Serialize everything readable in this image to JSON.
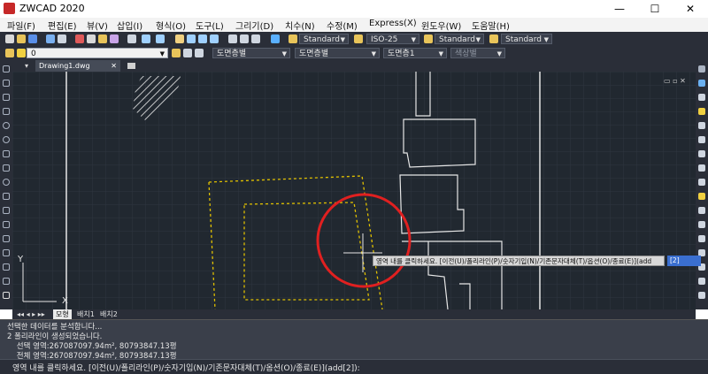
{
  "window": {
    "title": "ZWCAD 2020",
    "min": "—",
    "max": "☐",
    "close": "✕"
  },
  "menu": [
    {
      "label": "파일(F)"
    },
    {
      "label": "편집(E)"
    },
    {
      "label": "뷰(V)"
    },
    {
      "label": "삽입(I)"
    },
    {
      "label": "형식(O)"
    },
    {
      "label": "도구(L)"
    },
    {
      "label": "그리기(D)"
    },
    {
      "label": "치수(N)"
    },
    {
      "label": "수정(M)"
    },
    {
      "label": "Express(X)"
    },
    {
      "label": "윈도우(W)"
    },
    {
      "label": "도움말(H)"
    }
  ],
  "toolbar1": {
    "text_style": "Standard",
    "dim_style": "ISO-25",
    "table_style": "Standard",
    "mleader_style": "Standard"
  },
  "toolbar2": {
    "layer": "0",
    "color": "도면층별",
    "linetype": "도면층별",
    "lineweight": "도면층1",
    "plot_style": "색상별"
  },
  "tabs": {
    "document": "Drawing1.dwg"
  },
  "layout_tabs": [
    "모형",
    "배치1",
    "배치2"
  ],
  "ucs": {
    "x_label": "X",
    "y_label": "Y"
  },
  "tooltip": {
    "prompt": "영역 내를 클릭하세요. [이전(U)/폴리라인(P)/숫자기입(N)/기존문자대체(T)/옵션(O)/종료(E)](add",
    "value": "[2]"
  },
  "history": [
    "선택한 데이터를 분석합니다...",
    "2 폴리라인이 생성되었습니다.",
    "    선택 영역:267087097.94m², 80793847.13평",
    "    전체 영역:267087097.94m², 80793847.13평"
  ],
  "command_line": "영역 내를 클릭하세요. [이전(U)/폴리라인(P)/숫자기입(N)/기존문자대체(T)/옵션(O)/종료(E)](add[2]):",
  "colors": {
    "canvas": "#212830",
    "annotation_circle": "#e02020",
    "dashed_boundary": "#e0c000"
  }
}
